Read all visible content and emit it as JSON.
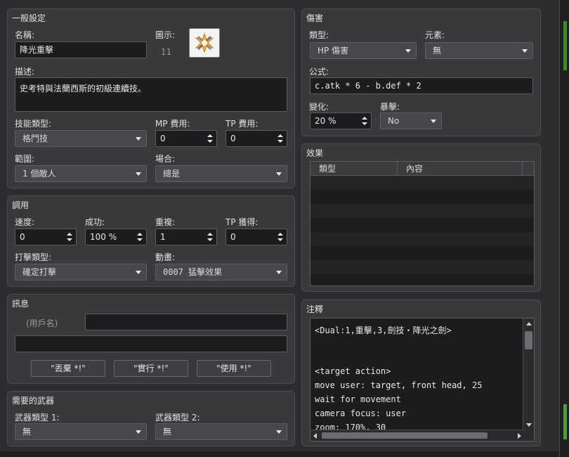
{
  "general": {
    "title": "一般設定",
    "name_label": "名稱:",
    "name_value": "降光重擊",
    "icon_label": "圖示:",
    "icon_index": "11",
    "description_label": "描述:",
    "description_value": "史考特與法蘭西斯的初級連續技。",
    "skill_type_label": "技能類型:",
    "skill_type_value": "格鬥技",
    "mp_cost_label": "MP 費用:",
    "mp_cost_value": "0",
    "tp_cost_label": "TP 費用:",
    "tp_cost_value": "0",
    "scope_label": "範圍:",
    "scope_value": "1 個敵人",
    "occasion_label": "場合:",
    "occasion_value": "總是"
  },
  "invocation": {
    "title": "調用",
    "speed_label": "速度:",
    "speed_value": "0",
    "success_label": "成功:",
    "success_value": "100 %",
    "repeat_label": "重複:",
    "repeat_value": "1",
    "tp_gain_label": "TP 獲得:",
    "tp_gain_value": "0",
    "hit_type_label": "打擊類型:",
    "hit_type_value": "確定打擊",
    "animation_label": "動畫:",
    "animation_value": "0007 猛擊效果"
  },
  "message": {
    "title": "訊息",
    "user_name_label": "(用戶名)",
    "line1": "",
    "line2": "",
    "buttons": [
      "\"丟棄 *!\"",
      "\"實行 *!\"",
      "\"使用 *!\""
    ]
  },
  "weapons": {
    "title": "需要的武器",
    "type1_label": "武器類型 1:",
    "type1_value": "無",
    "type2_label": "武器類型 2:",
    "type2_value": "無"
  },
  "damage": {
    "title": "傷害",
    "type_label": "類型:",
    "type_value": "HP 傷害",
    "element_label": "元素:",
    "element_value": "無",
    "formula_label": "公式:",
    "formula_value": "c.atk * 6 - b.def * 2",
    "variance_label": "變化:",
    "variance_value": "20 %",
    "critical_label": "暴擊:",
    "critical_value": "No"
  },
  "effects": {
    "title": "效果",
    "columns": [
      "類型",
      "內容"
    ]
  },
  "note": {
    "title": "注釋",
    "lines": [
      "<Dual:1,重擊,3,劍技・降光之劍>",
      "",
      "",
      "<target action>",
      "move user: target, front head, 25",
      "wait for movement",
      "camera focus: user",
      "zoom: 170%, 30"
    ]
  },
  "colors": {
    "background": "#2b2d2f",
    "panel": "#37393b",
    "field": "#1b1c1d",
    "combo": "#46484b"
  }
}
